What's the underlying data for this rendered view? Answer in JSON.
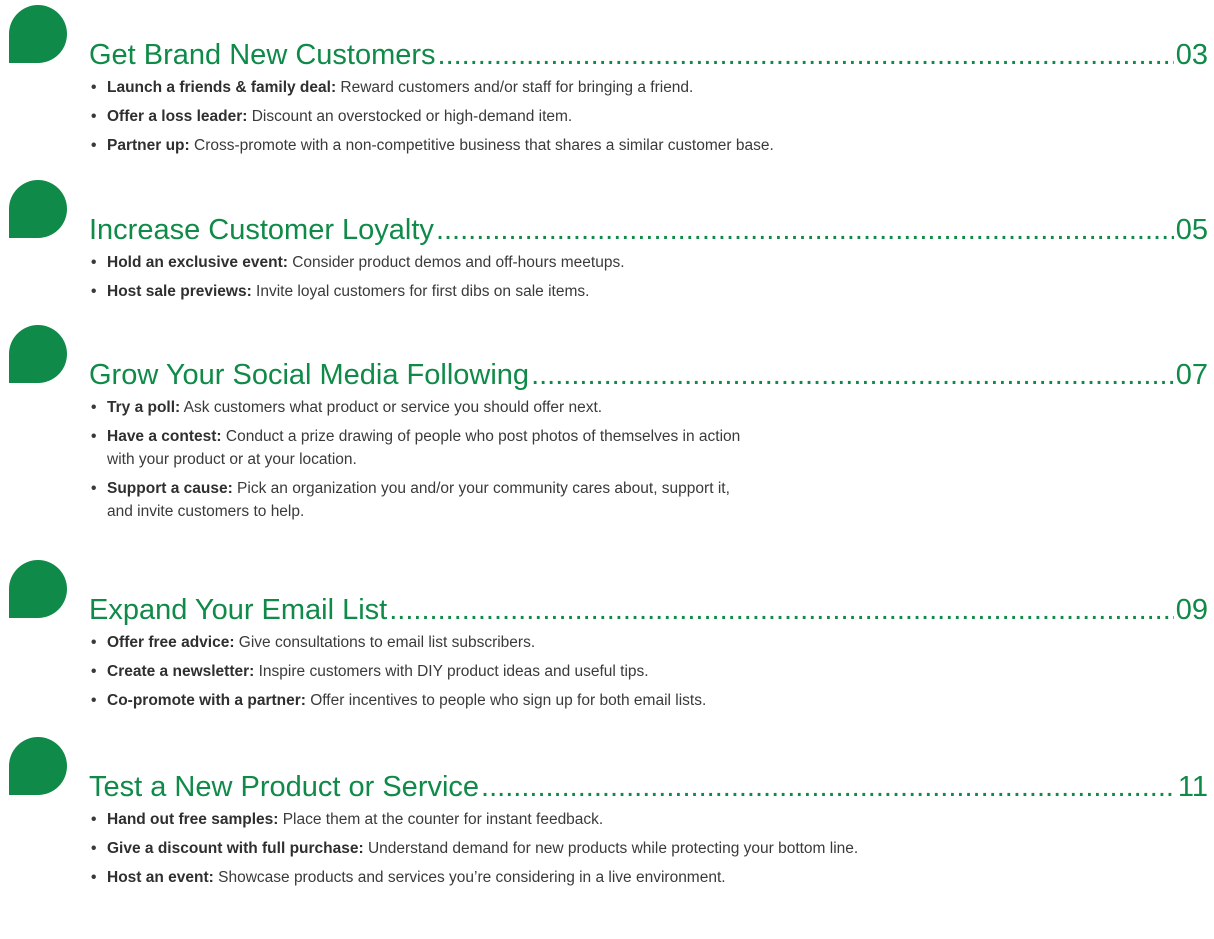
{
  "colors": {
    "accent": "#0f8a48",
    "body_text": "#3a3a3a"
  },
  "sections": [
    {
      "title": "Get Brand New Customers",
      "page": "03",
      "items": [
        {
          "lead": "Launch a friends & family deal:",
          "text": " Reward customers and/or staff for bringing a friend.",
          "cont": ""
        },
        {
          "lead": "Offer a loss leader:",
          "text": " Discount an overstocked or high-demand item.",
          "cont": ""
        },
        {
          "lead": "Partner up:",
          "text": " Cross-promote with a non-competitive business that shares a similar customer base.",
          "cont": ""
        }
      ]
    },
    {
      "title": "Increase Customer Loyalty",
      "page": "05",
      "items": [
        {
          "lead": "Hold an exclusive event:",
          "text": " Consider product demos and off-hours meetups.",
          "cont": ""
        },
        {
          "lead": "Host sale previews:",
          "text": " Invite loyal customers for first dibs on sale items.",
          "cont": ""
        }
      ]
    },
    {
      "title": "Grow Your Social Media Following",
      "page": "07",
      "items": [
        {
          "lead": "Try a poll:",
          "text": " Ask customers what product or service you should offer next.",
          "cont": ""
        },
        {
          "lead": "Have a contest:",
          "text": " Conduct a prize drawing of people who post photos of themselves in action",
          "cont": "with your product or at your location."
        },
        {
          "lead": "Support a cause:",
          "text": " Pick an organization you and/or your community cares about, support it,",
          "cont": "and invite customers to help."
        }
      ]
    },
    {
      "title": "Expand Your Email List",
      "page": "09",
      "items": [
        {
          "lead": "Offer free advice:",
          "text": " Give consultations to email list subscribers.",
          "cont": ""
        },
        {
          "lead": "Create a newsletter:",
          "text": " Inspire customers with DIY product ideas and useful tips.",
          "cont": ""
        },
        {
          "lead": "Co-promote with a partner:",
          "text": " Offer incentives to people who sign up for both email lists.",
          "cont": ""
        }
      ]
    },
    {
      "title": "Test a New Product or Service",
      "page": "11",
      "items": [
        {
          "lead": "Hand out free samples:",
          "text": " Place them at the counter for instant feedback.",
          "cont": ""
        },
        {
          "lead": "Give a discount with full purchase:",
          "text": " Understand demand for new products while protecting your bottom line.",
          "cont": ""
        },
        {
          "lead": "Host an event:",
          "text": " Showcase products and services you’re considering in a live environment.",
          "cont": ""
        }
      ]
    }
  ]
}
